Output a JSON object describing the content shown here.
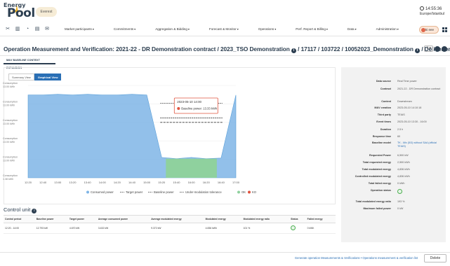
{
  "app": {
    "logo_top": "Energy",
    "logo_main": "Pool",
    "environment": "Everest",
    "time": "14:55:36",
    "timezone": "Europe/Istanbul",
    "user": "ki eee"
  },
  "nav": {
    "icons": [
      "tools-icon",
      "trash-icon",
      "clock-icon",
      "document-icon",
      "mail-icon"
    ],
    "items": [
      {
        "label": "Market participants"
      },
      {
        "label": "Commitments"
      },
      {
        "label": "Aggregation & Bidding"
      },
      {
        "label": "Forecast & Monitor"
      },
      {
        "label": "Operations"
      },
      {
        "label": "Perf. Report & Billing"
      },
      {
        "label": "Data"
      },
      {
        "label": "Administration"
      }
    ]
  },
  "title": {
    "part1": "Operation Measurement and Verification: 2021-22 - DR Demonstration contract / 2023_TSO Demonstration",
    "part2": "/ 17117 / 103722 / 10052023_Demonstration",
    "part3": "/ Deliver energy"
  },
  "subtab": "M&V BASELINE CONTEXT EXPANSION",
  "view_buttons": {
    "summary": "Summary View",
    "graph": "Graphical View"
  },
  "chart_data": {
    "type": "area",
    "x": [
      "12:20",
      "12:40",
      "13:00",
      "13:20",
      "13:40",
      "14:00",
      "14:20",
      "14:40",
      "15:00",
      "15:20",
      "15:40",
      "16:00",
      "16:20",
      "16:40",
      "17:00"
    ],
    "y_ticks": [
      "Consumption 13.00 kWh",
      "Consumption 13.00 kWh",
      "Consumption 13.00 kWh",
      "Consumption 13.00 kWh",
      "Consumption 13.00 kWh",
      "Consumption 1.38 kWh"
    ],
    "consumed": [
      13.0,
      13.0,
      13.1,
      13.0,
      13.1,
      13.0,
      13.0,
      13.1,
      13.0,
      3.2,
      3.0,
      3.2,
      3.0,
      3.1,
      13.0
    ],
    "ko_window": [
      "15:20",
      "16:40"
    ],
    "target_power": 8.7,
    "baseline_power": 11.7,
    "under_modulation_tolerance": 9.4,
    "tooltip": {
      "time": "2023-05-10 14:00",
      "label": "Baseline power",
      "value": "13.33 kWh"
    },
    "legend": [
      {
        "name": "Consumed power",
        "color": "#7fb5e6"
      },
      {
        "name": "Target power",
        "color": "#333333"
      },
      {
        "name": "Baseline power",
        "color": "#333333"
      },
      {
        "name": "Under-modulation tolerance",
        "color": "#333333"
      },
      {
        "name": "OK",
        "color": "#8fd19e"
      },
      {
        "name": "KO",
        "color": "#e0533f"
      }
    ]
  },
  "control": {
    "title": "Control unit",
    "headers": [
      "Control period",
      "Baseline power",
      "Target power",
      "Average consumed power",
      "Average modulated energy",
      "Modulated energy",
      "Modulated energy ratio",
      "Status",
      "Failed energy"
    ],
    "rows": [
      [
        "12:20 - 14:00",
        "12.793 kW",
        "4.670 kW",
        "3.432 kW",
        "9.372 kW",
        "4.836 kWh",
        "101 %",
        "",
        "0 kWh"
      ]
    ]
  },
  "right": {
    "rows": [
      {
        "label": "Data source",
        "value": "Real Time power"
      },
      {
        "label": "Contract",
        "value": "2021-22 - DR Demonstration contract"
      },
      {
        "label": "Context",
        "value": "Downstream"
      },
      {
        "label": "M&V creation",
        "value": "2023-05-10 14:10:18"
      },
      {
        "label": "Third party",
        "value": "TEIAS"
      },
      {
        "label": "Event times",
        "value": "2023-05-10 13:30 - 16:00"
      },
      {
        "label": "Duration",
        "value": "2.5 h"
      },
      {
        "label": "Response time",
        "value": "60"
      },
      {
        "label": "Baseline model",
        "value": "TK - Mix (5/3) without SAA (official TEIAS)"
      },
      {
        "label": "Requested Power",
        "value": "6,500 kW"
      },
      {
        "label": "Total requested energy",
        "value": "2,500 kWh"
      },
      {
        "label": "Total modulated energy",
        "value": "4,836 kWh"
      },
      {
        "label": "Controlled modulated energy",
        "value": "4,836 kWh"
      },
      {
        "label": "Total failed energy",
        "value": "0 kWh"
      },
      {
        "label": "Operation status",
        "value": ""
      },
      {
        "label": "Total modulated energy ratio",
        "value": "193 %"
      },
      {
        "label": "Maximum failed power",
        "value": "0 kW"
      }
    ]
  },
  "footer": {
    "links": "Generate operation Measurements & Verifications  •  Operations measurement & verification list",
    "delete": "Delete"
  }
}
